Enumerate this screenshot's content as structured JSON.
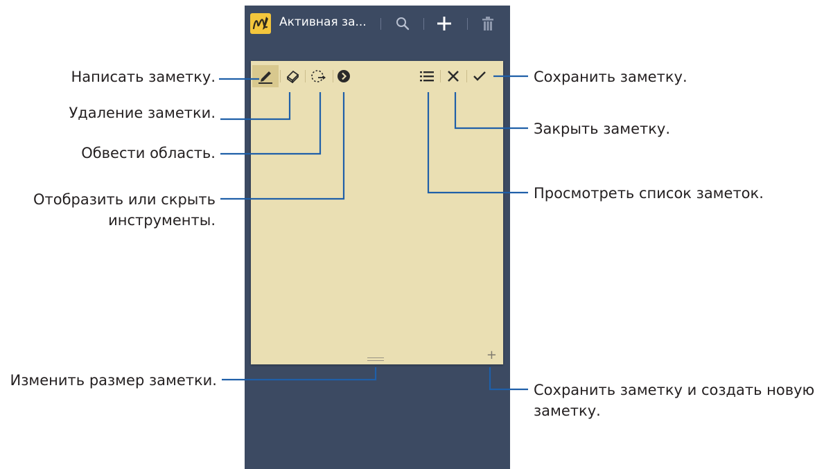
{
  "appbar": {
    "title": "Активная за...",
    "logo_icon": "pen-note-icon",
    "search_icon": "search-icon",
    "add_icon": "plus-icon",
    "delete_icon": "trash-icon"
  },
  "note_toolbar": {
    "pen_icon": "pen-icon",
    "eraser_icon": "eraser-icon",
    "lasso_icon": "lasso-select-icon",
    "toggle_icon": "chevron-right-circle-icon",
    "list_icon": "list-icon",
    "close_icon": "close-icon",
    "save_icon": "check-icon"
  },
  "note": {
    "new_note_glyph": "+"
  },
  "callouts": {
    "write_note": "Написать заметку.",
    "delete_note": "Удаление заметки.",
    "select_area": "Обвести область.",
    "toggle_tools_line1": "Отобразить или скрыть",
    "toggle_tools_line2": "инструменты.",
    "resize_note": "Изменить размер заметки.",
    "save_note": "Сохранить заметку.",
    "close_note": "Закрыть заметку.",
    "view_list": "Просмотреть список заметок.",
    "save_and_new_line1": "Сохранить заметку и создать новую",
    "save_and_new_line2": "заметку."
  },
  "colors": {
    "phone_bg": "#3c4a62",
    "note_bg": "#eadfb3",
    "logo_bg": "#f3c63c",
    "callout_line": "#1f5fa8"
  }
}
